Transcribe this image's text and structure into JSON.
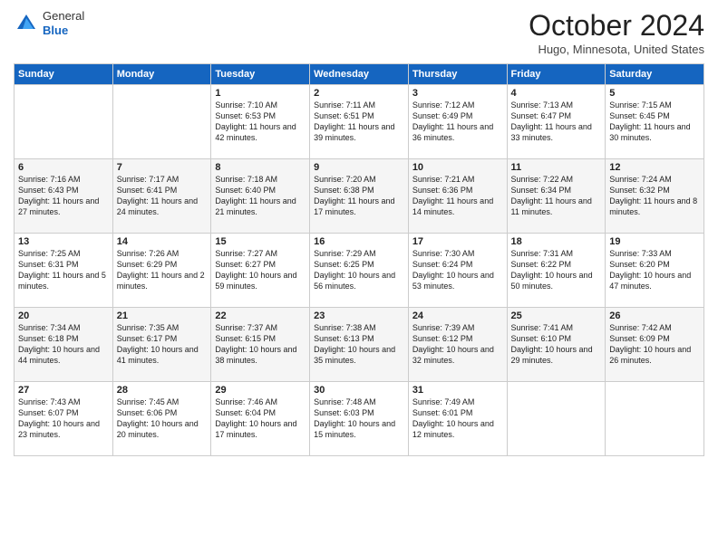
{
  "header": {
    "logo": {
      "general": "General",
      "blue": "Blue"
    },
    "title": "October 2024",
    "location": "Hugo, Minnesota, United States"
  },
  "weekdays": [
    "Sunday",
    "Monday",
    "Tuesday",
    "Wednesday",
    "Thursday",
    "Friday",
    "Saturday"
  ],
  "weeks": [
    [
      {
        "day": "",
        "info": ""
      },
      {
        "day": "",
        "info": ""
      },
      {
        "day": "1",
        "info": "Sunrise: 7:10 AM\nSunset: 6:53 PM\nDaylight: 11 hours and 42 minutes."
      },
      {
        "day": "2",
        "info": "Sunrise: 7:11 AM\nSunset: 6:51 PM\nDaylight: 11 hours and 39 minutes."
      },
      {
        "day": "3",
        "info": "Sunrise: 7:12 AM\nSunset: 6:49 PM\nDaylight: 11 hours and 36 minutes."
      },
      {
        "day": "4",
        "info": "Sunrise: 7:13 AM\nSunset: 6:47 PM\nDaylight: 11 hours and 33 minutes."
      },
      {
        "day": "5",
        "info": "Sunrise: 7:15 AM\nSunset: 6:45 PM\nDaylight: 11 hours and 30 minutes."
      }
    ],
    [
      {
        "day": "6",
        "info": "Sunrise: 7:16 AM\nSunset: 6:43 PM\nDaylight: 11 hours and 27 minutes."
      },
      {
        "day": "7",
        "info": "Sunrise: 7:17 AM\nSunset: 6:41 PM\nDaylight: 11 hours and 24 minutes."
      },
      {
        "day": "8",
        "info": "Sunrise: 7:18 AM\nSunset: 6:40 PM\nDaylight: 11 hours and 21 minutes."
      },
      {
        "day": "9",
        "info": "Sunrise: 7:20 AM\nSunset: 6:38 PM\nDaylight: 11 hours and 17 minutes."
      },
      {
        "day": "10",
        "info": "Sunrise: 7:21 AM\nSunset: 6:36 PM\nDaylight: 11 hours and 14 minutes."
      },
      {
        "day": "11",
        "info": "Sunrise: 7:22 AM\nSunset: 6:34 PM\nDaylight: 11 hours and 11 minutes."
      },
      {
        "day": "12",
        "info": "Sunrise: 7:24 AM\nSunset: 6:32 PM\nDaylight: 11 hours and 8 minutes."
      }
    ],
    [
      {
        "day": "13",
        "info": "Sunrise: 7:25 AM\nSunset: 6:31 PM\nDaylight: 11 hours and 5 minutes."
      },
      {
        "day": "14",
        "info": "Sunrise: 7:26 AM\nSunset: 6:29 PM\nDaylight: 11 hours and 2 minutes."
      },
      {
        "day": "15",
        "info": "Sunrise: 7:27 AM\nSunset: 6:27 PM\nDaylight: 10 hours and 59 minutes."
      },
      {
        "day": "16",
        "info": "Sunrise: 7:29 AM\nSunset: 6:25 PM\nDaylight: 10 hours and 56 minutes."
      },
      {
        "day": "17",
        "info": "Sunrise: 7:30 AM\nSunset: 6:24 PM\nDaylight: 10 hours and 53 minutes."
      },
      {
        "day": "18",
        "info": "Sunrise: 7:31 AM\nSunset: 6:22 PM\nDaylight: 10 hours and 50 minutes."
      },
      {
        "day": "19",
        "info": "Sunrise: 7:33 AM\nSunset: 6:20 PM\nDaylight: 10 hours and 47 minutes."
      }
    ],
    [
      {
        "day": "20",
        "info": "Sunrise: 7:34 AM\nSunset: 6:18 PM\nDaylight: 10 hours and 44 minutes."
      },
      {
        "day": "21",
        "info": "Sunrise: 7:35 AM\nSunset: 6:17 PM\nDaylight: 10 hours and 41 minutes."
      },
      {
        "day": "22",
        "info": "Sunrise: 7:37 AM\nSunset: 6:15 PM\nDaylight: 10 hours and 38 minutes."
      },
      {
        "day": "23",
        "info": "Sunrise: 7:38 AM\nSunset: 6:13 PM\nDaylight: 10 hours and 35 minutes."
      },
      {
        "day": "24",
        "info": "Sunrise: 7:39 AM\nSunset: 6:12 PM\nDaylight: 10 hours and 32 minutes."
      },
      {
        "day": "25",
        "info": "Sunrise: 7:41 AM\nSunset: 6:10 PM\nDaylight: 10 hours and 29 minutes."
      },
      {
        "day": "26",
        "info": "Sunrise: 7:42 AM\nSunset: 6:09 PM\nDaylight: 10 hours and 26 minutes."
      }
    ],
    [
      {
        "day": "27",
        "info": "Sunrise: 7:43 AM\nSunset: 6:07 PM\nDaylight: 10 hours and 23 minutes."
      },
      {
        "day": "28",
        "info": "Sunrise: 7:45 AM\nSunset: 6:06 PM\nDaylight: 10 hours and 20 minutes."
      },
      {
        "day": "29",
        "info": "Sunrise: 7:46 AM\nSunset: 6:04 PM\nDaylight: 10 hours and 17 minutes."
      },
      {
        "day": "30",
        "info": "Sunrise: 7:48 AM\nSunset: 6:03 PM\nDaylight: 10 hours and 15 minutes."
      },
      {
        "day": "31",
        "info": "Sunrise: 7:49 AM\nSunset: 6:01 PM\nDaylight: 10 hours and 12 minutes."
      },
      {
        "day": "",
        "info": ""
      },
      {
        "day": "",
        "info": ""
      }
    ]
  ]
}
